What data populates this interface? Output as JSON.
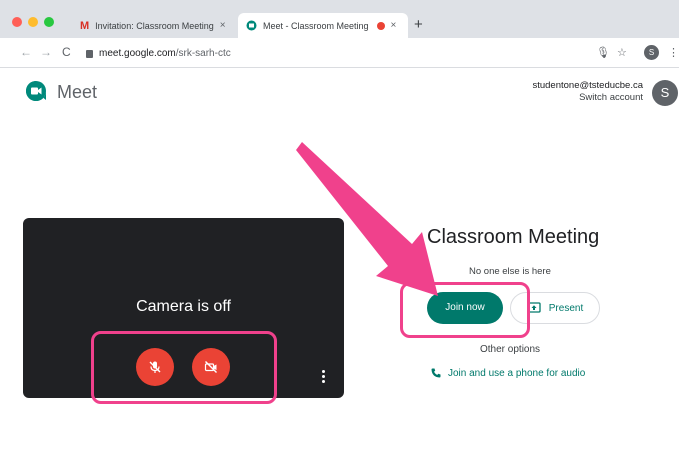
{
  "browser": {
    "tabs": [
      {
        "label": "Invitation: Classroom Meeting",
        "close": "×"
      },
      {
        "label": "Meet - Classroom Meeting",
        "close": "×"
      }
    ],
    "new_tab": "+",
    "url_host": "meet.google.com",
    "url_path": "/srk-sarh-ctc",
    "profile_initial": "S"
  },
  "meet": {
    "app_name": "Meet",
    "account_email": "studentone@tsteducbe.ca",
    "switch_account": "Switch account",
    "avatar_initial": "S"
  },
  "preview": {
    "status": "Camera is off"
  },
  "panel": {
    "meeting_title": "Classroom Meeting",
    "status": "No one else is here",
    "join_label": "Join now",
    "present_label": "Present",
    "other_options": "Other options",
    "phone_label": "Join and use a phone for audio"
  },
  "colors": {
    "accent_teal": "#00796b",
    "mic_cam_red": "#ea4335",
    "highlight_pink": "#f0418c",
    "preview_bg": "#202124"
  },
  "icons": {
    "mic": "mic-off-icon",
    "camera": "camera-off-icon",
    "present": "present-screen-icon",
    "phone": "phone-icon"
  }
}
